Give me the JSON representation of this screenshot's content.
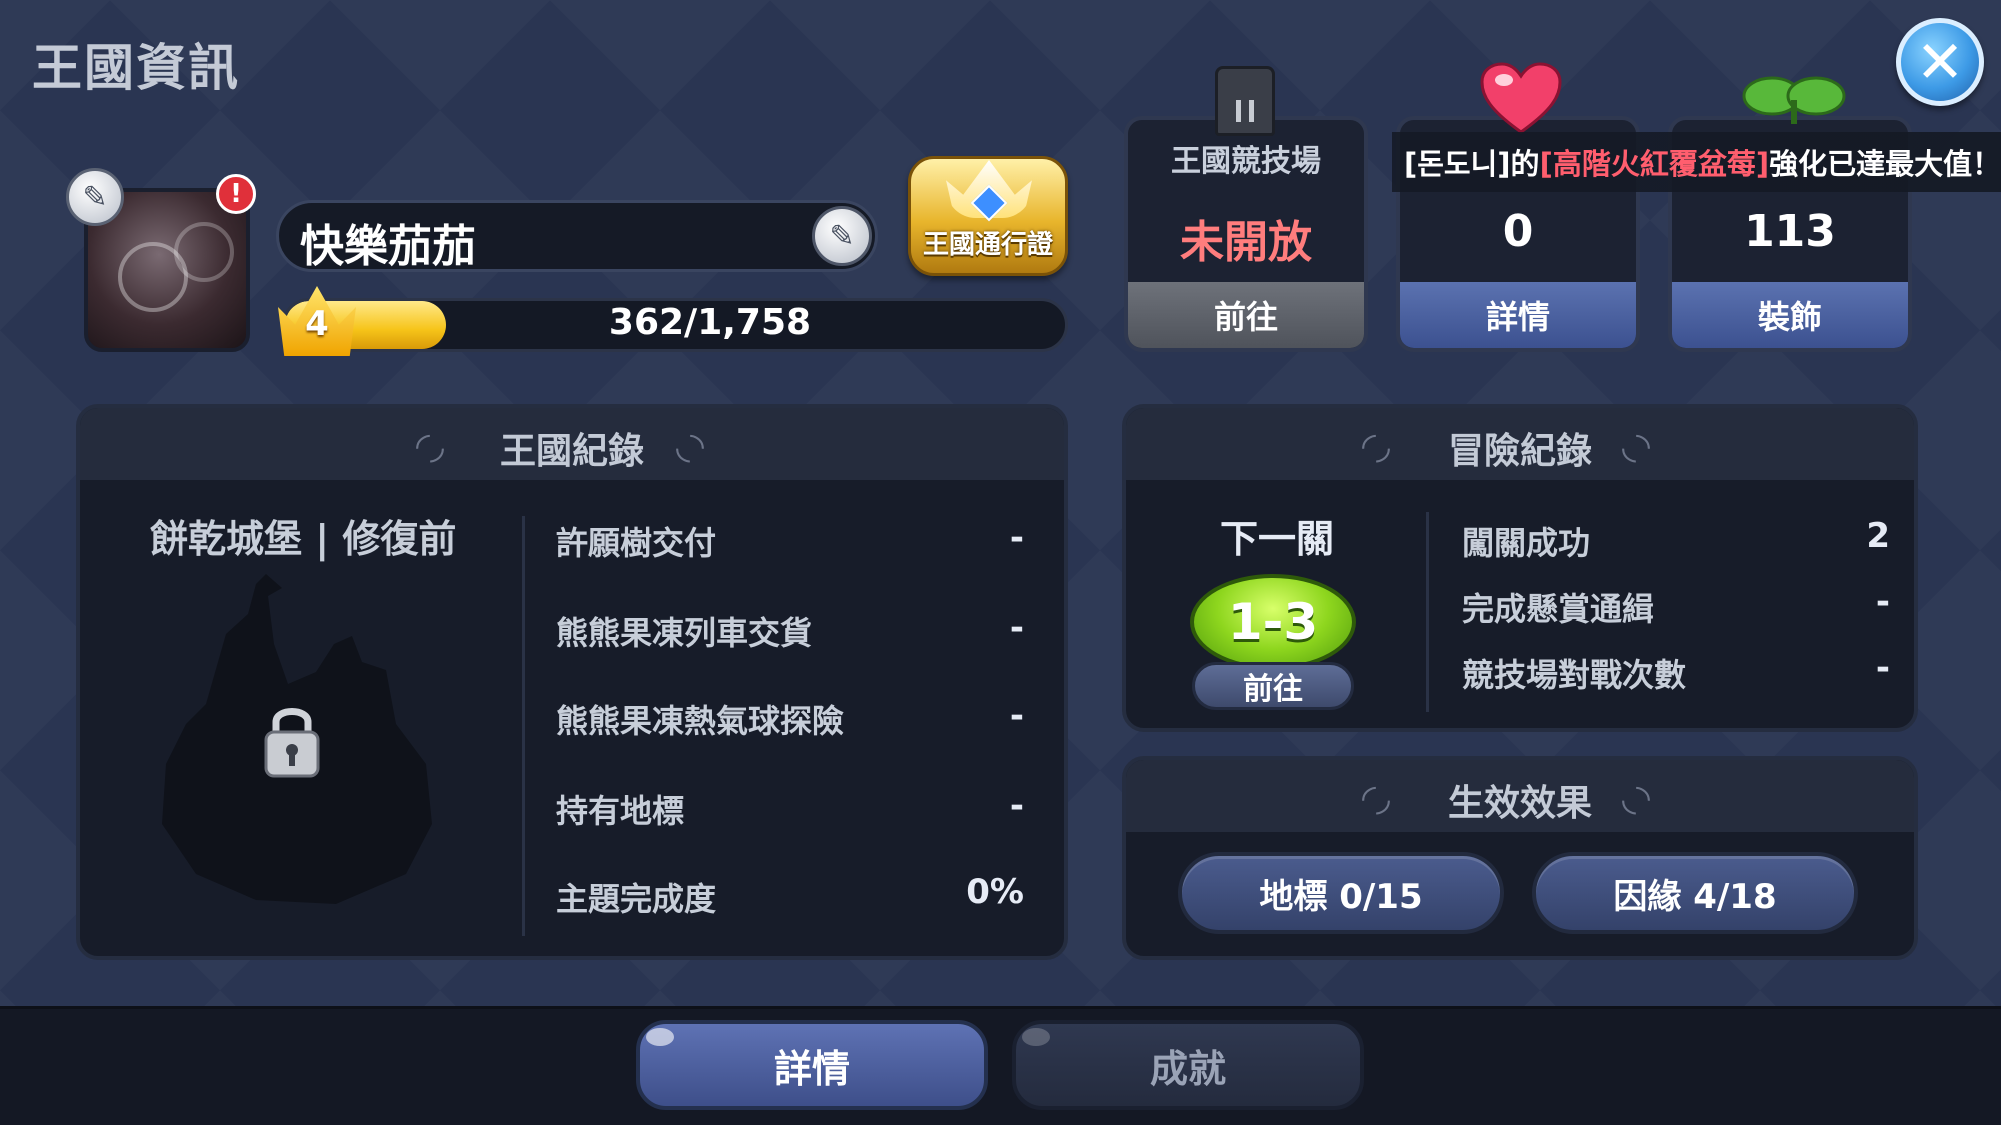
{
  "window": {
    "title": "王國資訊"
  },
  "profile": {
    "name": "快樂茄茄",
    "level": "4",
    "exp_text": "362/1,758",
    "exp_progress": 0.206,
    "alert_badge": "!",
    "pass_label": "王國通行證"
  },
  "cards": [
    {
      "title": "王國競技場",
      "value": "未開放",
      "value_color": "#ff7d7d",
      "button": "前往",
      "button_style": "gray",
      "icon": "arena-gate-icon"
    },
    {
      "title": "",
      "value": "0",
      "value_color": "#ffffff",
      "button": "詳情",
      "button_style": "blue",
      "icon": "heart-icon"
    },
    {
      "title": "",
      "value": "113",
      "value_color": "#ffffff",
      "button": "裝飾",
      "button_style": "blue",
      "icon": "leaf-icon"
    }
  ],
  "toast": {
    "prefix": "[돈도니]的",
    "highlight": "[高階火紅覆盆莓]",
    "suffix": "強化已達最大值！"
  },
  "kingdom_record": {
    "title": "王國紀錄",
    "castle_name": "餅乾城堡 | 修復前",
    "stats": [
      {
        "label": "許願樹交付",
        "value": "-"
      },
      {
        "label": "熊熊果凍列車交貨",
        "value": "-"
      },
      {
        "label": "熊熊果凍熱氣球探險",
        "value": "-"
      },
      {
        "label": "持有地標",
        "value": "-"
      },
      {
        "label": "主題完成度",
        "value": "0%"
      }
    ]
  },
  "adventure_record": {
    "title": "冒險紀錄",
    "next_label": "下一關",
    "stage": "1-3",
    "go_button": "前往",
    "stats": [
      {
        "label": "闖關成功",
        "value": "2"
      },
      {
        "label": "完成懸賞通緝",
        "value": "-"
      },
      {
        "label": "競技場對戰次數",
        "value": "-"
      }
    ]
  },
  "effects": {
    "title": "生效效果",
    "landmark_button": "地標 0/15",
    "bond_button": "因緣 4/18"
  },
  "tabs": [
    {
      "label": "詳情",
      "active": true
    },
    {
      "label": "成就",
      "active": false
    }
  ],
  "colors": {
    "background": "#2a3552",
    "panel": "#171c29",
    "accent_blue": "#3e4f8a",
    "exp_yellow": "#f6c419",
    "stage_green": "#8ed61e",
    "toast_highlight": "#ff5e6e"
  }
}
